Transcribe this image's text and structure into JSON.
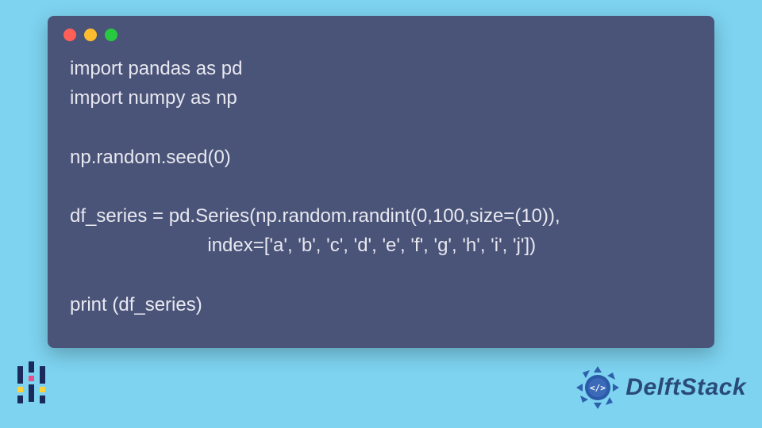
{
  "code": {
    "lines": [
      "import pandas as pd",
      "import numpy as np",
      "",
      "np.random.seed(0)",
      "",
      "df_series = pd.Series(np.random.randint(0,100,size=(10)),",
      "                          index=['a', 'b', 'c', 'd', 'e', 'f', 'g', 'h', 'i', 'j'])",
      "",
      "print (df_series)"
    ]
  },
  "branding": {
    "right_text": "DelftStack"
  },
  "colors": {
    "background": "#7dd3f0",
    "window": "#4a5478",
    "dot_red": "#ff5f57",
    "dot_yellow": "#febc2e",
    "dot_green": "#28c840",
    "brand_text": "#2a4a7a"
  }
}
